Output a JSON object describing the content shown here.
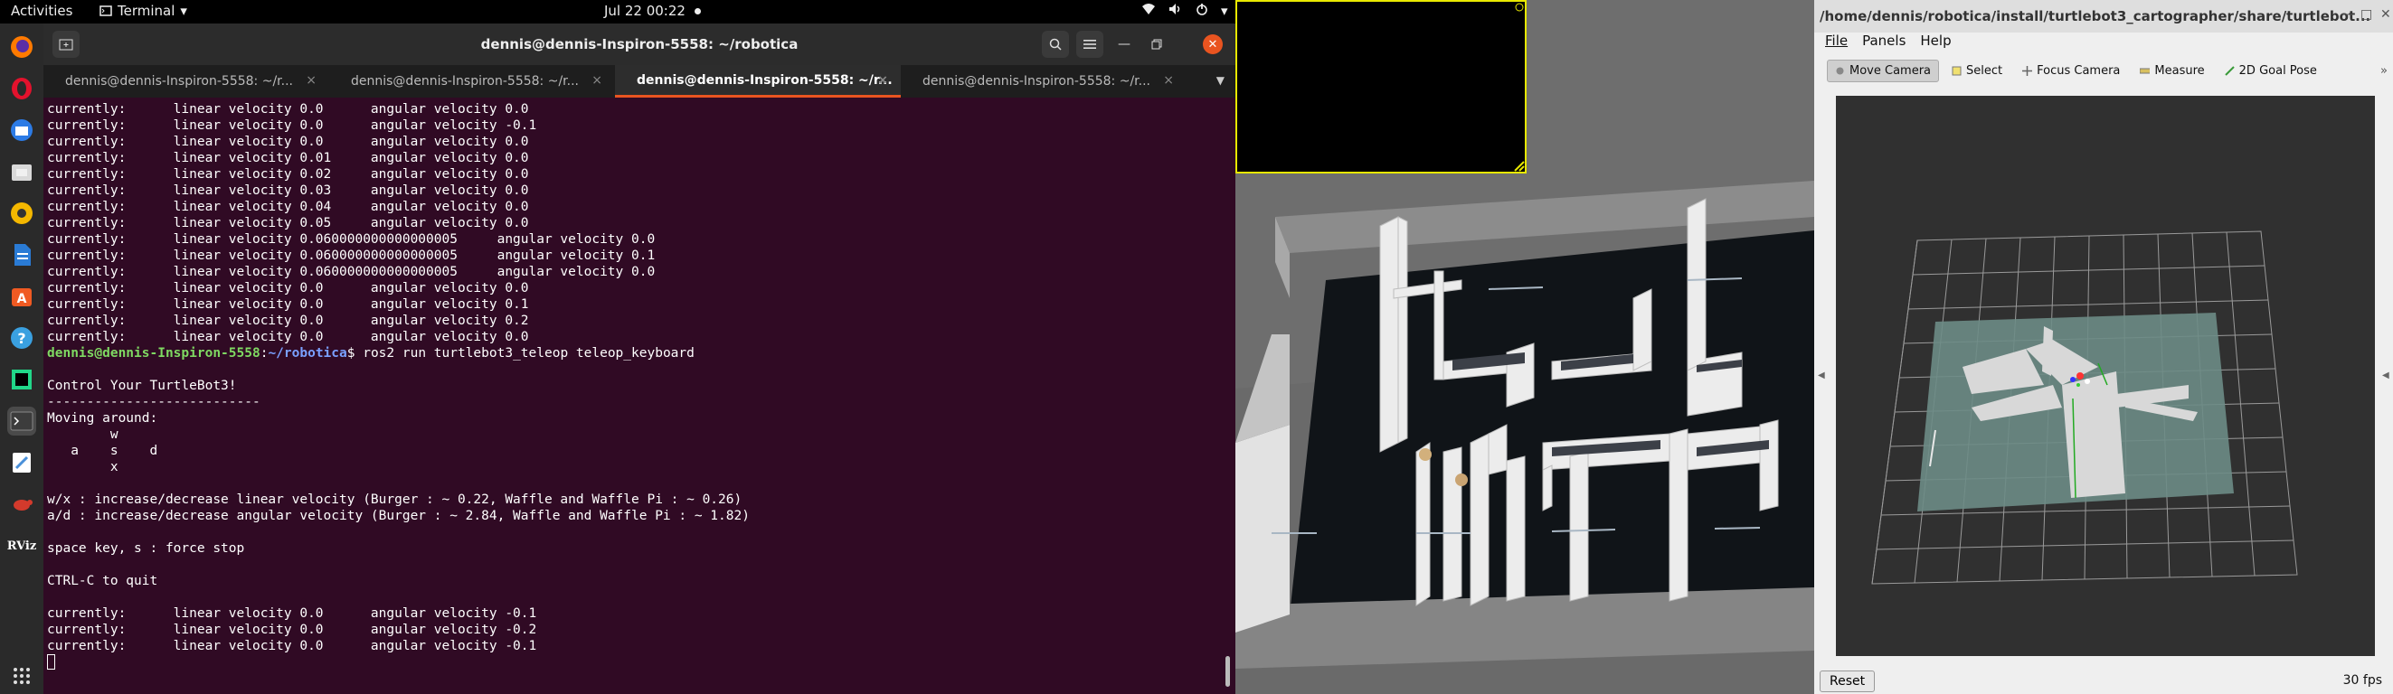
{
  "topbar": {
    "activities": "Activities",
    "app_name": "Terminal",
    "clock": "Jul 22  00:22"
  },
  "dock": {
    "items": [
      {
        "name": "firefox-icon",
        "color": "#ff7a00"
      },
      {
        "name": "opera-icon",
        "color": "#e3122d"
      },
      {
        "name": "thunderbird-icon",
        "color": "#2c7be5"
      },
      {
        "name": "files-icon",
        "color": "#d9d9d9"
      },
      {
        "name": "rhythmbox-icon",
        "color": "#f5b800"
      },
      {
        "name": "libreoffice-writer-icon",
        "color": "#2a7bd5"
      },
      {
        "name": "ubuntu-software-icon",
        "color": "#f05a22"
      },
      {
        "name": "help-icon",
        "color": "#3aa0e0"
      },
      {
        "name": "pycharm-icon",
        "color": "#21d789"
      },
      {
        "name": "terminal-icon",
        "color": "#3c3c3c"
      },
      {
        "name": "text-editor-icon",
        "color": "#4a90d9"
      },
      {
        "name": "ros-turtle-icon",
        "color": "#d33a2c"
      },
      {
        "name": "rviz-icon",
        "color": "#333333"
      }
    ],
    "rviz_label": "RViz",
    "apps_grid_label": "⋮⋮⋮"
  },
  "terminal": {
    "title": "dennis@dennis-Inspiron-5558: ~/robotica",
    "tabs": [
      {
        "label": "dennis@dennis-Inspiron-5558: ~/r...",
        "active": false
      },
      {
        "label": "dennis@dennis-Inspiron-5558: ~/r...",
        "active": false
      },
      {
        "label": "dennis@dennis-Inspiron-5558: ~/r...",
        "active": true
      },
      {
        "label": "dennis@dennis-Inspiron-5558: ~/r...",
        "active": false
      }
    ],
    "lines_before": [
      "currently:      linear velocity 0.0      angular velocity 0.0",
      "currently:      linear velocity 0.0      angular velocity -0.1",
      "currently:      linear velocity 0.0      angular velocity 0.0",
      "currently:      linear velocity 0.01     angular velocity 0.0",
      "currently:      linear velocity 0.02     angular velocity 0.0",
      "currently:      linear velocity 0.03     angular velocity 0.0",
      "currently:      linear velocity 0.04     angular velocity 0.0",
      "currently:      linear velocity 0.05     angular velocity 0.0",
      "currently:      linear velocity 0.060000000000000005     angular velocity 0.0",
      "currently:      linear velocity 0.060000000000000005     angular velocity 0.1",
      "currently:      linear velocity 0.060000000000000005     angular velocity 0.0",
      "currently:      linear velocity 0.0      angular velocity 0.0",
      "currently:      linear velocity 0.0      angular velocity 0.1",
      "currently:      linear velocity 0.0      angular velocity 0.2",
      "currently:      linear velocity 0.0      angular velocity 0.0"
    ],
    "prompt_user": "dennis@dennis-Inspiron-5558",
    "prompt_sep": ":",
    "prompt_path": "~/robotica",
    "prompt_command": "$ ros2 run turtlebot3_teleop teleop_keyboard",
    "lines_after": [
      "",
      "Control Your TurtleBot3!",
      "---------------------------",
      "Moving around:",
      "        w",
      "   a    s    d",
      "        x",
      "",
      "w/x : increase/decrease linear velocity (Burger : ~ 0.22, Waffle and Waffle Pi : ~ 0.26)",
      "a/d : increase/decrease angular velocity (Burger : ~ 2.84, Waffle and Waffle Pi : ~ 1.82)",
      "",
      "space key, s : force stop",
      "",
      "CTRL-C to quit",
      "",
      "currently:      linear velocity 0.0      angular velocity -0.1",
      "currently:      linear velocity 0.0      angular velocity -0.2",
      "currently:      linear velocity 0.0      angular velocity -0.1"
    ]
  },
  "rviz": {
    "title": "/home/dennis/robotica/install/turtlebot3_cartographer/share/turtlebot...",
    "menu": [
      "File",
      "Panels",
      "Help"
    ],
    "tools": [
      {
        "name": "move-camera-tool",
        "label": "Move Camera",
        "active": true
      },
      {
        "name": "select-tool",
        "label": "Select",
        "active": false
      },
      {
        "name": "focus-camera-tool",
        "label": "Focus Camera",
        "active": false
      },
      {
        "name": "measure-tool",
        "label": "Measure",
        "active": false
      },
      {
        "name": "2d-goal-pose-tool",
        "label": "2D Goal Pose",
        "active": false
      }
    ],
    "reset_label": "Reset",
    "fps": "30 fps"
  }
}
